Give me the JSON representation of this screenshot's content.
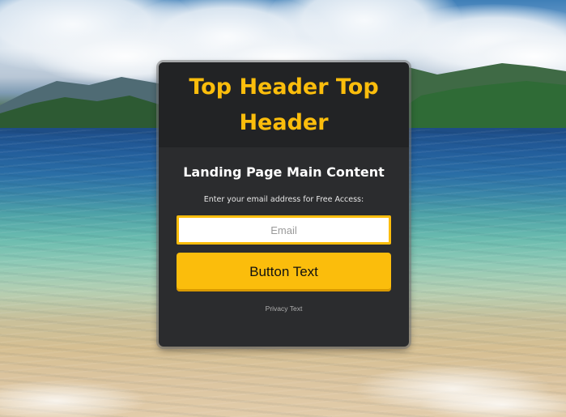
{
  "colors": {
    "accent": "#fbbd0c",
    "card_background": "#2b2c2e",
    "header_background": "#222325"
  },
  "background": {
    "image": "beach-sea-mountains-photo"
  },
  "card": {
    "header_title": "Top Header Top Header",
    "main_title": "Landing Page Main Content",
    "email_prompt": "Enter your email address for Free Access:",
    "email_input": {
      "value": "",
      "placeholder": "Email"
    },
    "button_label": "Button Text",
    "privacy_text": "Privacy Text"
  }
}
